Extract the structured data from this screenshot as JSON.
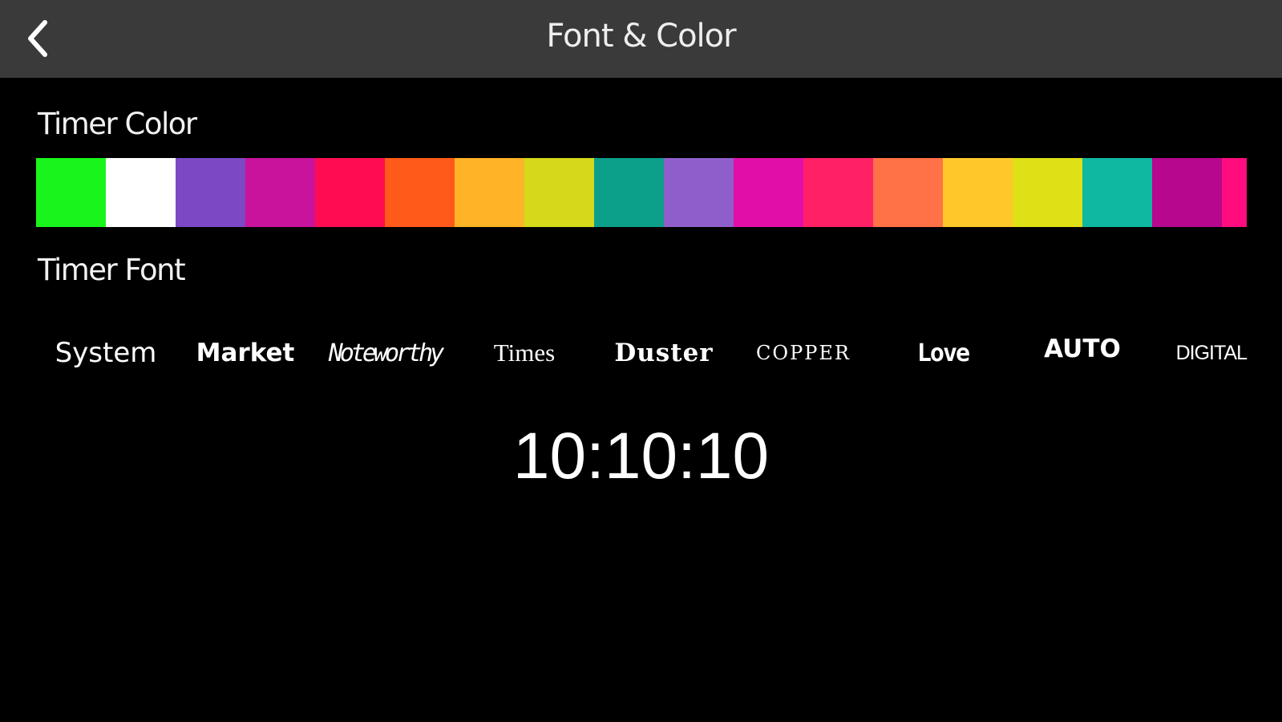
{
  "nav": {
    "title": "Font & Color",
    "back_icon": "chevron-left-icon"
  },
  "color_section": {
    "label": "Timer Color",
    "swatches": [
      "#19f51c",
      "#ffffff",
      "#7c48c4",
      "#c9139c",
      "#ff0c52",
      "#ff5a1a",
      "#ffb327",
      "#d4da1a",
      "#0c9f8a",
      "#8f5ecb",
      "#e10fa7",
      "#ff2066",
      "#ff7147",
      "#ffc82a",
      "#dfe016",
      "#0fb8a1",
      "#b6078e",
      "#ff0d7f"
    ]
  },
  "font_section": {
    "label": "Timer Font",
    "options": [
      "System",
      "Market",
      "Noteworthy",
      "Times",
      "Duster",
      "COPPER",
      "Love",
      "AUTO",
      "DIGITAL"
    ]
  },
  "preview": {
    "time": "10:10:10"
  }
}
